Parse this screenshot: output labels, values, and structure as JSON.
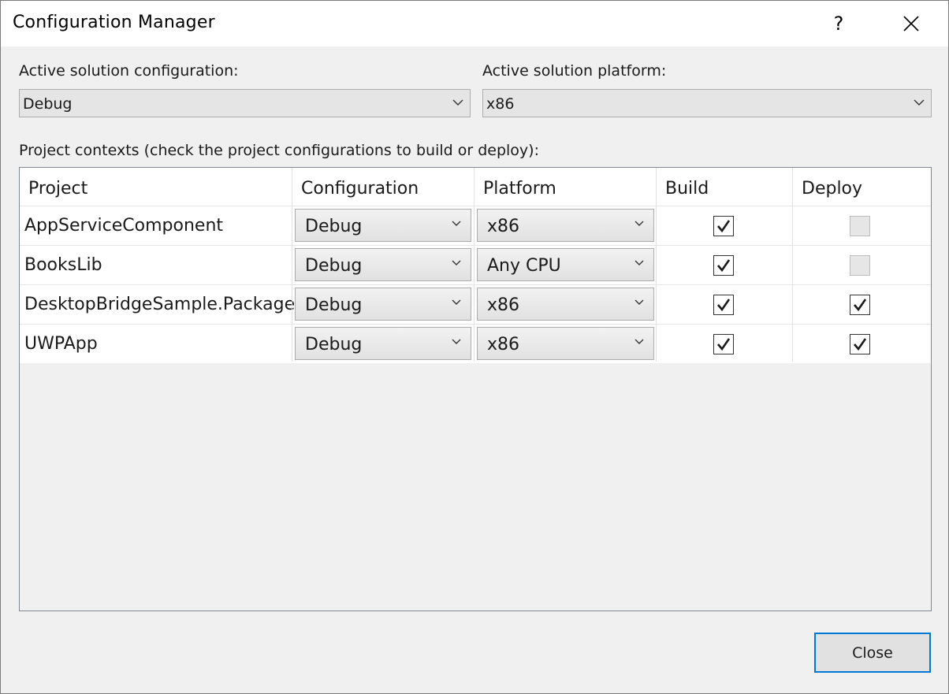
{
  "window": {
    "title": "Configuration Manager",
    "help_glyph": "?",
    "close_icon": "close-icon"
  },
  "solution": {
    "config_label": "Active solution configuration:",
    "config_value": "Debug",
    "platform_label": "Active solution platform:",
    "platform_value": "x86"
  },
  "contexts_label": "Project contexts (check the project configurations to build or deploy):",
  "grid": {
    "headers": [
      "Project",
      "Configuration",
      "Platform",
      "Build",
      "Deploy"
    ],
    "rows": [
      {
        "project": "AppServiceComponent",
        "configuration": "Debug",
        "platform": "x86",
        "build": true,
        "deploy": false,
        "deploy_enabled": false
      },
      {
        "project": "BooksLib",
        "configuration": "Debug",
        "platform": "Any CPU",
        "build": true,
        "deploy": false,
        "deploy_enabled": false
      },
      {
        "project": "DesktopBridgeSample.Package",
        "configuration": "Debug",
        "platform": "x86",
        "build": true,
        "deploy": true,
        "deploy_enabled": true
      },
      {
        "project": "UWPApp",
        "configuration": "Debug",
        "platform": "x86",
        "build": true,
        "deploy": true,
        "deploy_enabled": true
      }
    ]
  },
  "buttons": {
    "close_label": "Close"
  },
  "colors": {
    "accent": "#0078d7",
    "dialog_bg": "#f0f0f0"
  }
}
